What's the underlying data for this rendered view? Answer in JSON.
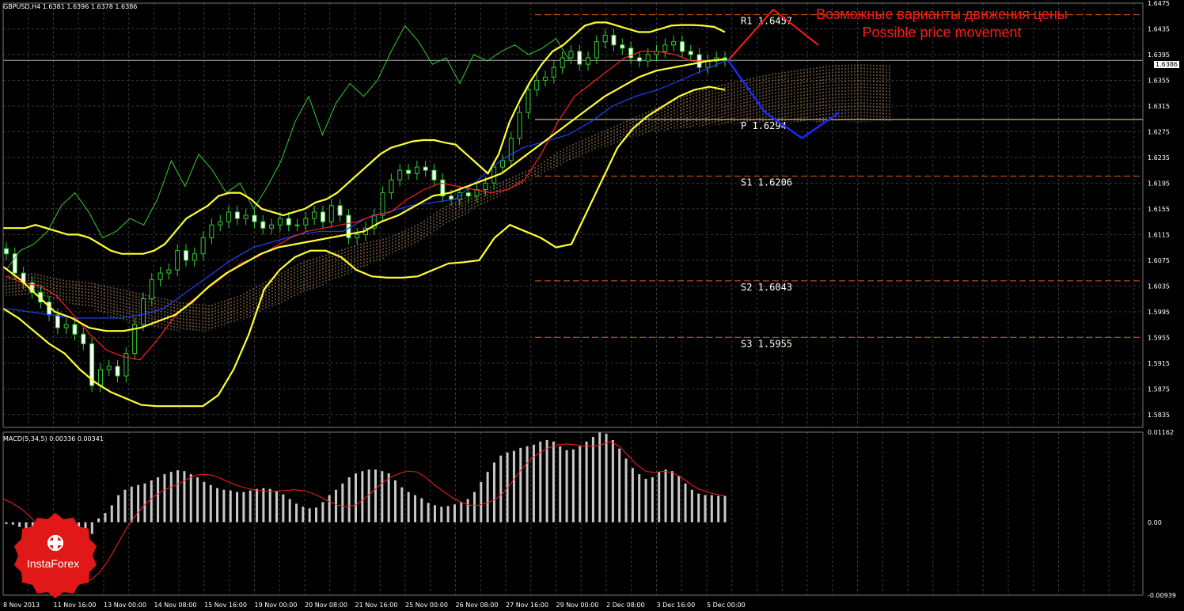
{
  "header": {
    "symbol_info": "GBPUSD,H4  1.6381 1.6396 1.6378 1.6386",
    "macd_info": "MACD(5,34,5) 0.00336 0.00341",
    "current_price_tag": "1.6386"
  },
  "annotation": {
    "line1": "Возможные варианты движения цены",
    "line2": "Possible price movement"
  },
  "logo": {
    "text": "InstaForex",
    "icon": "instaforex-emblem-icon"
  },
  "colors": {
    "background": "#000000",
    "grid": "#3a3a3a",
    "bollinger": "#ffff33",
    "candle": "#32cd32",
    "tenkan": "#ff2020",
    "kijun": "#2040ff",
    "chikou": "#33cc33",
    "cloud": "#e8b27a",
    "pivot_line": "#f5deb3",
    "forecast_up": "#ff1a1a",
    "forecast_down": "#1a2aff",
    "macd_hist": "#c8c8c8",
    "macd_signal": "#ff2020",
    "axis_text": "#ffffff"
  },
  "chart_data": [
    {
      "type": "line",
      "title": "GBPUSD,H4",
      "ylim": [
        1.5815,
        1.6475
      ],
      "y_ticks": [
        "1.6475",
        "1.6435",
        "1.6395",
        "1.6355",
        "1.6315",
        "1.6275",
        "1.6235",
        "1.6195",
        "1.6155",
        "1.6115",
        "1.6075",
        "1.6035",
        "1.5995",
        "1.5955",
        "1.5915",
        "1.5875",
        "1.5835"
      ],
      "x_ticks": [
        "8 Nov 2013",
        "11 Nov 16:00",
        "13 Nov 00:00",
        "14 Nov 08:00",
        "15 Nov 16:00",
        "19 Nov 00:00",
        "20 Nov 08:00",
        "21 Nov 16:00",
        "25 Nov 00:00",
        "26 Nov 08:00",
        "27 Nov 16:00",
        "29 Nov 00:00",
        "2 Dec 08:00",
        "3 Dec 16:00",
        "5 Dec 00:00"
      ],
      "grid": true,
      "levels": [
        {
          "name": "R1",
          "value": 1.6457,
          "label": "R1  1.6457",
          "style": "dashed"
        },
        {
          "name": "P",
          "value": 1.6294,
          "label": "P  1.6294",
          "style": "solid"
        },
        {
          "name": "S1",
          "value": 1.6206,
          "label": "S1  1.6206",
          "style": "dashed"
        },
        {
          "name": "S2",
          "value": 1.6043,
          "label": "S2  1.6043",
          "style": "dashed"
        },
        {
          "name": "S3",
          "value": 1.5955,
          "label": "S3  1.5955",
          "style": "dashed"
        }
      ],
      "series": [
        {
          "id": "close",
          "values": [
            1.6085,
            1.6055,
            1.604,
            1.6025,
            1.601,
            1.599,
            1.597,
            1.5975,
            1.596,
            1.5945,
            1.588,
            1.5905,
            1.591,
            1.5895,
            1.593,
            1.5975,
            1.6015,
            1.6045,
            1.6055,
            1.606,
            1.609,
            1.6075,
            1.6085,
            1.611,
            1.613,
            1.6135,
            1.615,
            1.614,
            1.6145,
            1.6135,
            1.6125,
            1.613,
            1.614,
            1.613,
            1.613,
            1.614,
            1.615,
            1.6135,
            1.616,
            1.6145,
            1.611,
            1.6115,
            1.6125,
            1.6145,
            1.618,
            1.62,
            1.6215,
            1.621,
            1.622,
            1.6215,
            1.62,
            1.6175,
            1.617,
            1.618,
            1.6175,
            1.6185,
            1.6195,
            1.622,
            1.623,
            1.6265,
            1.6305,
            1.634,
            1.6355,
            1.636,
            1.6375,
            1.639,
            1.64,
            1.638,
            1.639,
            1.6415,
            1.6425,
            1.641,
            1.6405,
            1.639,
            1.6385,
            1.6395,
            1.64,
            1.641,
            1.6415,
            1.64,
            1.6395,
            1.6375,
            1.6385,
            1.639,
            1.6386
          ]
        },
        {
          "id": "bb_upper",
          "values": [
            1.6125,
            1.6125,
            1.6125,
            1.613,
            1.6125,
            1.612,
            1.6115,
            1.6115,
            1.611,
            1.61,
            1.609,
            1.6085,
            1.6085,
            1.6085,
            1.609,
            1.61,
            1.612,
            1.614,
            1.615,
            1.616,
            1.6175,
            1.618,
            1.618,
            1.617,
            1.6155,
            1.615,
            1.6145,
            1.615,
            1.6155,
            1.6165,
            1.617,
            1.618,
            1.6195,
            1.621,
            1.6225,
            1.624,
            1.625,
            1.6255,
            1.626,
            1.6262,
            1.6262,
            1.6258,
            1.6255,
            1.624,
            1.6225,
            1.621,
            1.624,
            1.629,
            1.6325,
            1.6355,
            1.638,
            1.64,
            1.641,
            1.6425,
            1.644,
            1.6445,
            1.6445,
            1.644,
            1.6435,
            1.643,
            1.643,
            1.6435,
            1.644,
            1.6441,
            1.6441,
            1.644,
            1.6438,
            1.643
          ]
        },
        {
          "id": "bb_lower",
          "values": [
            1.6,
            1.5985,
            1.5965,
            1.5945,
            1.593,
            1.5905,
            1.5885,
            1.587,
            1.586,
            1.585,
            1.5848,
            1.5848,
            1.5848,
            1.5848,
            1.5865,
            1.5905,
            1.596,
            1.603,
            1.606,
            1.608,
            1.609,
            1.609,
            1.608,
            1.606,
            1.605,
            1.6048,
            1.6048,
            1.605,
            1.606,
            1.607,
            1.6072,
            1.6075,
            1.611,
            1.613,
            1.612,
            1.611,
            1.6095,
            1.61,
            1.615,
            1.62,
            1.625,
            1.628,
            1.63,
            1.6315,
            1.633,
            1.634,
            1.6345,
            1.634
          ]
        },
        {
          "id": "bb_mid",
          "values": [
            1.6065,
            1.6045,
            1.602,
            1.5995,
            1.5985,
            1.597,
            1.5965,
            1.5965,
            1.597,
            1.598,
            1.599,
            1.601,
            1.6035,
            1.6055,
            1.607,
            1.6085,
            1.6095,
            1.61,
            1.6105,
            1.611,
            1.6115,
            1.612,
            1.6135,
            1.6145,
            1.616,
            1.6175,
            1.618,
            1.619,
            1.62,
            1.621,
            1.623,
            1.625,
            1.627,
            1.629,
            1.631,
            1.633,
            1.6345,
            1.636,
            1.637,
            1.6375,
            1.638,
            1.6385,
            1.6388
          ]
        },
        {
          "id": "tenkan",
          "values": [
            1.605,
            1.604,
            1.6035,
            1.602,
            1.599,
            1.596,
            1.5935,
            1.5925,
            1.592,
            1.595,
            1.5985,
            1.601,
            1.603,
            1.605,
            1.607,
            1.608,
            1.6095,
            1.611,
            1.612,
            1.6125,
            1.613,
            1.6135,
            1.6145,
            1.615,
            1.617,
            1.6185,
            1.6195,
            1.619,
            1.6185,
            1.618,
            1.6185,
            1.62,
            1.624,
            1.629,
            1.633,
            1.635,
            1.637,
            1.639,
            1.64,
            1.64,
            1.6395,
            1.6385,
            1.6385,
            1.6388
          ]
        },
        {
          "id": "kijun",
          "values": [
            1.6,
            1.5995,
            1.599,
            1.5985,
            1.5985,
            1.5985,
            1.599,
            1.6,
            1.6025,
            1.605,
            1.6075,
            1.6095,
            1.6105,
            1.6115,
            1.612,
            1.612,
            1.614,
            1.615,
            1.616,
            1.6165,
            1.617,
            1.62,
            1.623,
            1.625,
            1.626,
            1.627,
            1.629,
            1.6315,
            1.633,
            1.634,
            1.6355,
            1.637,
            1.6385
          ]
        },
        {
          "id": "chikou",
          "values": [
            1.606,
            1.609,
            1.61,
            1.612,
            1.616,
            1.618,
            1.615,
            1.611,
            1.612,
            1.614,
            1.613,
            1.617,
            1.623,
            1.619,
            1.624,
            1.6215,
            1.618,
            1.6195,
            1.6155,
            1.619,
            1.623,
            1.629,
            1.633,
            1.627,
            1.632,
            1.635,
            1.633,
            1.6355,
            1.64,
            1.644,
            1.6415,
            1.638,
            1.639,
            1.635,
            1.6395,
            1.6385,
            1.64,
            1.641,
            1.6395,
            1.6405,
            1.642,
            1.6385
          ]
        },
        {
          "id": "cloud_top",
          "values": [
            1.605,
            1.6055,
            1.6045,
            1.604,
            1.603,
            1.602,
            1.601,
            1.6005,
            1.602,
            1.6045,
            1.607,
            1.6085,
            1.61,
            1.611,
            1.613,
            1.616,
            1.618,
            1.62,
            1.622,
            1.625,
            1.627,
            1.629,
            1.631,
            1.633,
            1.6345,
            1.6355,
            1.6365,
            1.6372,
            1.6378,
            1.638,
            1.6378
          ]
        },
        {
          "id": "cloud_bottom",
          "values": [
            1.602,
            1.602,
            1.601,
            1.6,
            1.598,
            1.597,
            1.5965,
            1.5965,
            1.598,
            1.6,
            1.602,
            1.604,
            1.606,
            1.608,
            1.61,
            1.613,
            1.6155,
            1.618,
            1.6205,
            1.6225,
            1.6245,
            1.6262,
            1.6275,
            1.628,
            1.6285,
            1.6288,
            1.629,
            1.629,
            1.629,
            1.629,
            1.629
          ]
        },
        {
          "id": "forecast_up",
          "values": [
            1.6386,
            1.6465,
            1.641
          ]
        },
        {
          "id": "forecast_down",
          "values": [
            1.6386,
            1.6305,
            1.6265,
            1.6305
          ]
        }
      ]
    },
    {
      "type": "bar",
      "title": "MACD(5,34,5)",
      "ylim": [
        -0.00939,
        0.01162
      ],
      "y_ticks": [
        "0.01162",
        "0.00",
        "-0.00939"
      ],
      "series": [
        {
          "id": "macd_hist",
          "values": [
            -0.0002,
            -0.0003,
            -0.0006,
            -0.0012,
            -0.0022,
            -0.0038,
            -0.0052,
            -0.0062,
            -0.007,
            -0.0074,
            -0.0072,
            -0.006,
            -0.004,
            -0.0015,
            0.0005,
            0.0012,
            0.0022,
            0.0035,
            0.0042,
            0.0046,
            0.0048,
            0.005,
            0.0054,
            0.0058,
            0.0062,
            0.0065,
            0.0067,
            0.0066,
            0.0062,
            0.0058,
            0.0052,
            0.0048,
            0.0044,
            0.0042,
            0.0041,
            0.0039,
            0.0039,
            0.0041,
            0.0043,
            0.0044,
            0.0043,
            0.004,
            0.0036,
            0.003,
            0.0024,
            0.002,
            0.0018,
            0.0019,
            0.0026,
            0.0035,
            0.0042,
            0.005,
            0.0058,
            0.0063,
            0.0066,
            0.0068,
            0.0068,
            0.0066,
            0.0063,
            0.0054,
            0.0045,
            0.0039,
            0.0035,
            0.0031,
            0.0025,
            0.0022,
            0.002,
            0.0021,
            0.0023,
            0.0026,
            0.003,
            0.0039,
            0.0052,
            0.0065,
            0.0077,
            0.0086,
            0.009,
            0.0092,
            0.0096,
            0.0098,
            0.01,
            0.0104,
            0.0106,
            0.0104,
            0.0098,
            0.0093,
            0.0094,
            0.0098,
            0.0104,
            0.011,
            0.0116,
            0.0114,
            0.0106,
            0.0095,
            0.0082,
            0.007,
            0.0062,
            0.0056,
            0.0058,
            0.0065,
            0.0068,
            0.0066,
            0.006,
            0.005,
            0.0042,
            0.0037,
            0.0035,
            0.0035,
            0.0034,
            0.0034
          ]
        },
        {
          "id": "macd_signal",
          "values": [
            0.003,
            0.0025,
            0.0018,
            0.0008,
            -0.0005,
            -0.0025,
            -0.0045,
            -0.0062,
            -0.0072,
            -0.0076,
            -0.0074,
            -0.0064,
            -0.0048,
            -0.0028,
            -0.0008,
            0.0008,
            0.0022,
            0.0032,
            0.004,
            0.0045,
            0.005,
            0.0056,
            0.0061,
            0.0062,
            0.006,
            0.0055,
            0.005,
            0.0046,
            0.0043,
            0.0041,
            0.004,
            0.004,
            0.0041,
            0.0042,
            0.0041,
            0.0038,
            0.0033,
            0.0027,
            0.0022,
            0.002,
            0.0022,
            0.003,
            0.004,
            0.005,
            0.0058,
            0.0063,
            0.0066,
            0.0065,
            0.0058,
            0.0048,
            0.004,
            0.0032,
            0.0026,
            0.0022,
            0.0022,
            0.0025,
            0.003,
            0.004,
            0.0055,
            0.007,
            0.0082,
            0.009,
            0.0096,
            0.01,
            0.0101,
            0.01,
            0.0098,
            0.0098,
            0.01,
            0.0104,
            0.0098,
            0.0086,
            0.0074,
            0.0066,
            0.0064,
            0.0066,
            0.0064,
            0.0058,
            0.005,
            0.0043,
            0.0039,
            0.0036,
            0.0034
          ]
        }
      ]
    }
  ]
}
